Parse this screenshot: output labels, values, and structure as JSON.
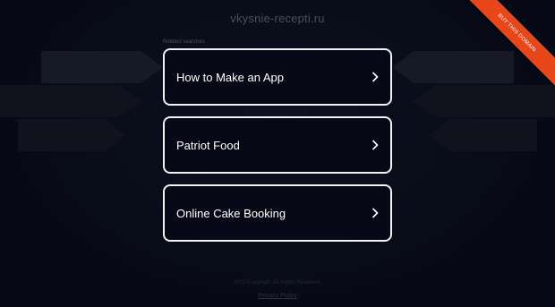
{
  "header": {
    "site_title": "vkysnie-recepti.ru"
  },
  "searches": {
    "label": "Related searches",
    "items": [
      {
        "label": "How to Make an App"
      },
      {
        "label": "Patriot Food"
      },
      {
        "label": "Online Cake Booking"
      }
    ]
  },
  "ribbon": {
    "label": "BUY THIS DOMAIN"
  },
  "footer": {
    "copyright": "2025 Copyright. All Rights Reserved.",
    "privacy": "Privacy Policy"
  },
  "colors": {
    "background": "#070a16",
    "card_border": "#f2f2f2",
    "ribbon": "#e8461b"
  },
  "icons": [
    "chevron-right-icon"
  ]
}
